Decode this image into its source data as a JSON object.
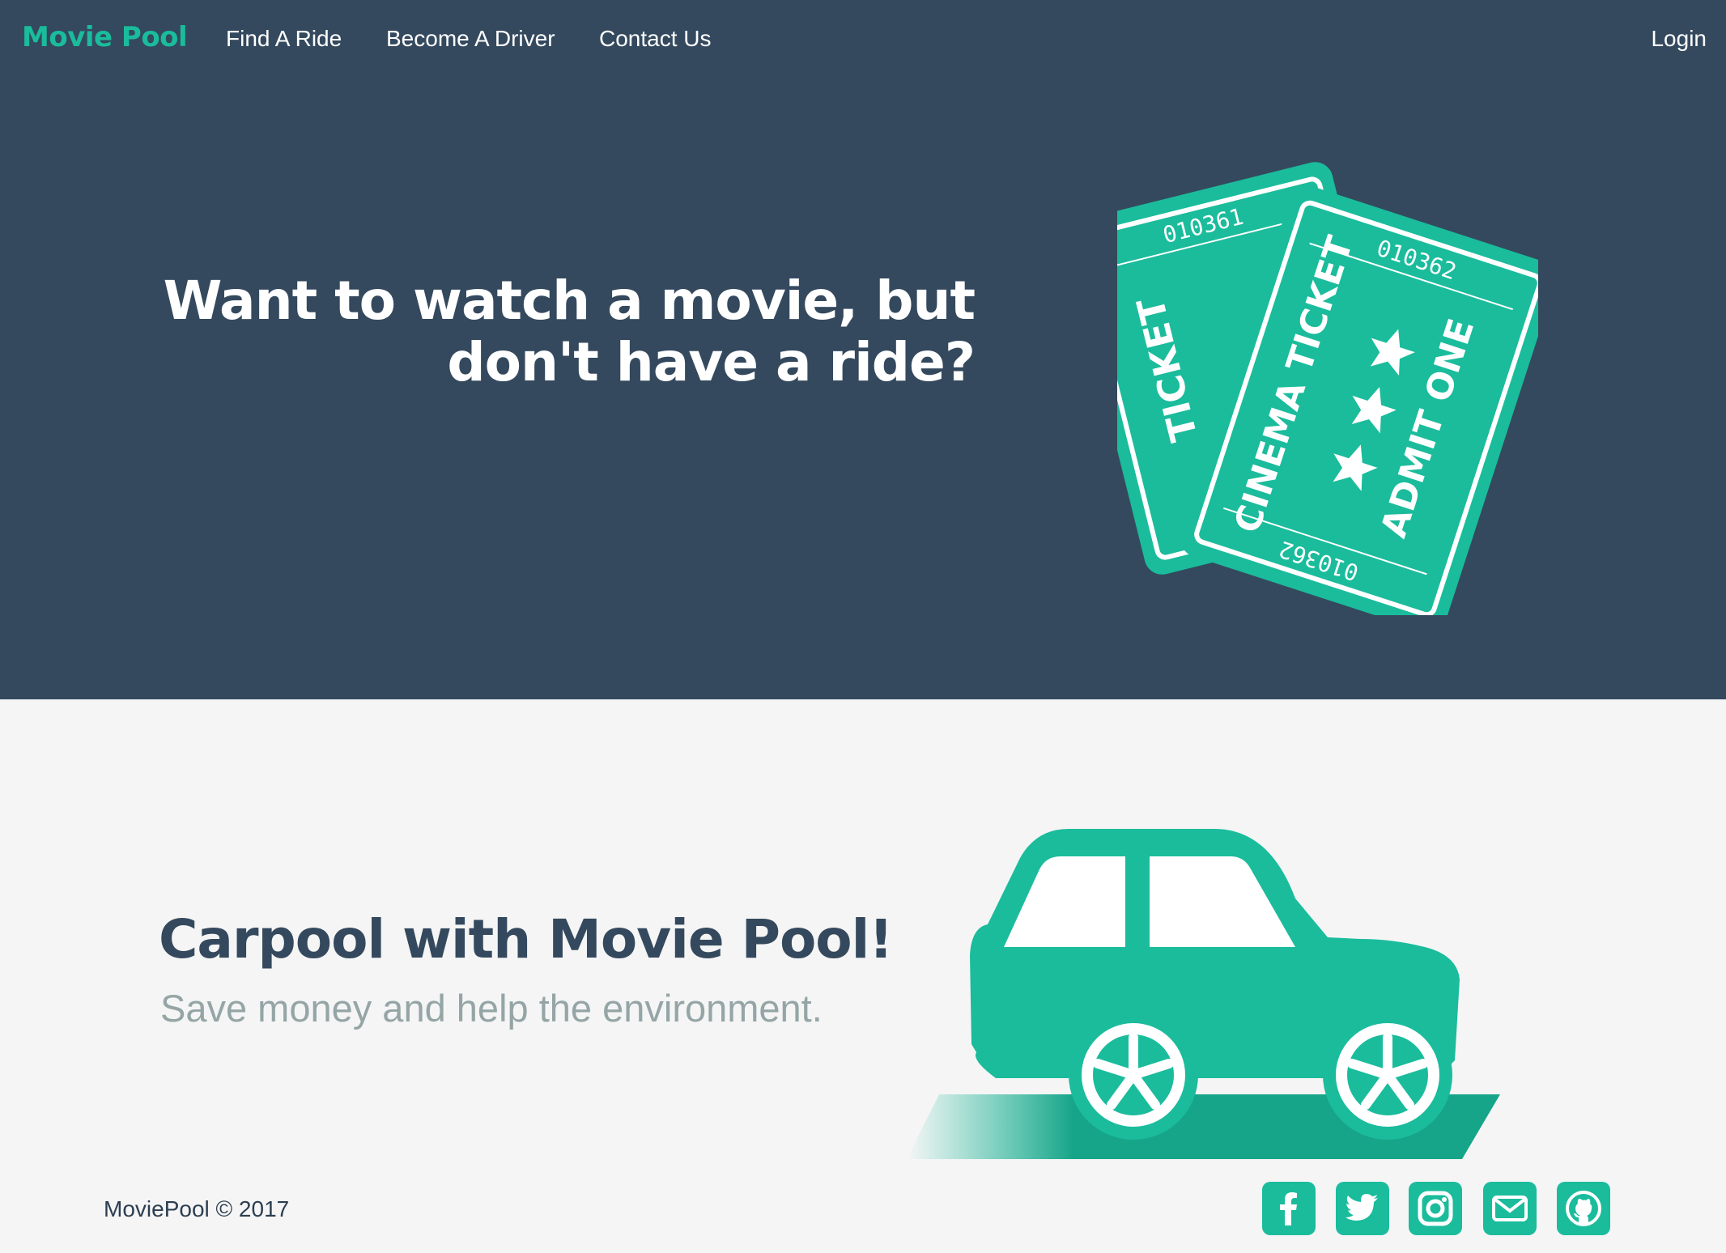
{
  "nav": {
    "brand": "Movie Pool",
    "links": [
      "Find A Ride",
      "Become A Driver",
      "Contact Us"
    ],
    "login": "Login"
  },
  "hero": {
    "title_line1": "Want to watch a movie, but",
    "title_line2": "don't have a ride?",
    "ticket_back": {
      "number": "010361",
      "label": "TICKET"
    },
    "ticket_front": {
      "number_top": "010362",
      "label": "CINEMA TICKET",
      "admit": "ADMIT ONE",
      "number_bottom": "010362"
    }
  },
  "promo": {
    "title": "Carpool with Movie Pool!",
    "subtitle": "Save money and help the environment."
  },
  "footer": {
    "copyright": "MoviePool © 2017",
    "social": [
      "facebook-icon",
      "twitter-icon",
      "instagram-icon",
      "email-icon",
      "github-icon"
    ]
  },
  "colors": {
    "accent": "#1abc9c",
    "navy": "#34495e",
    "light_bg": "#f5f5f5",
    "muted_text": "#95a5a6"
  }
}
